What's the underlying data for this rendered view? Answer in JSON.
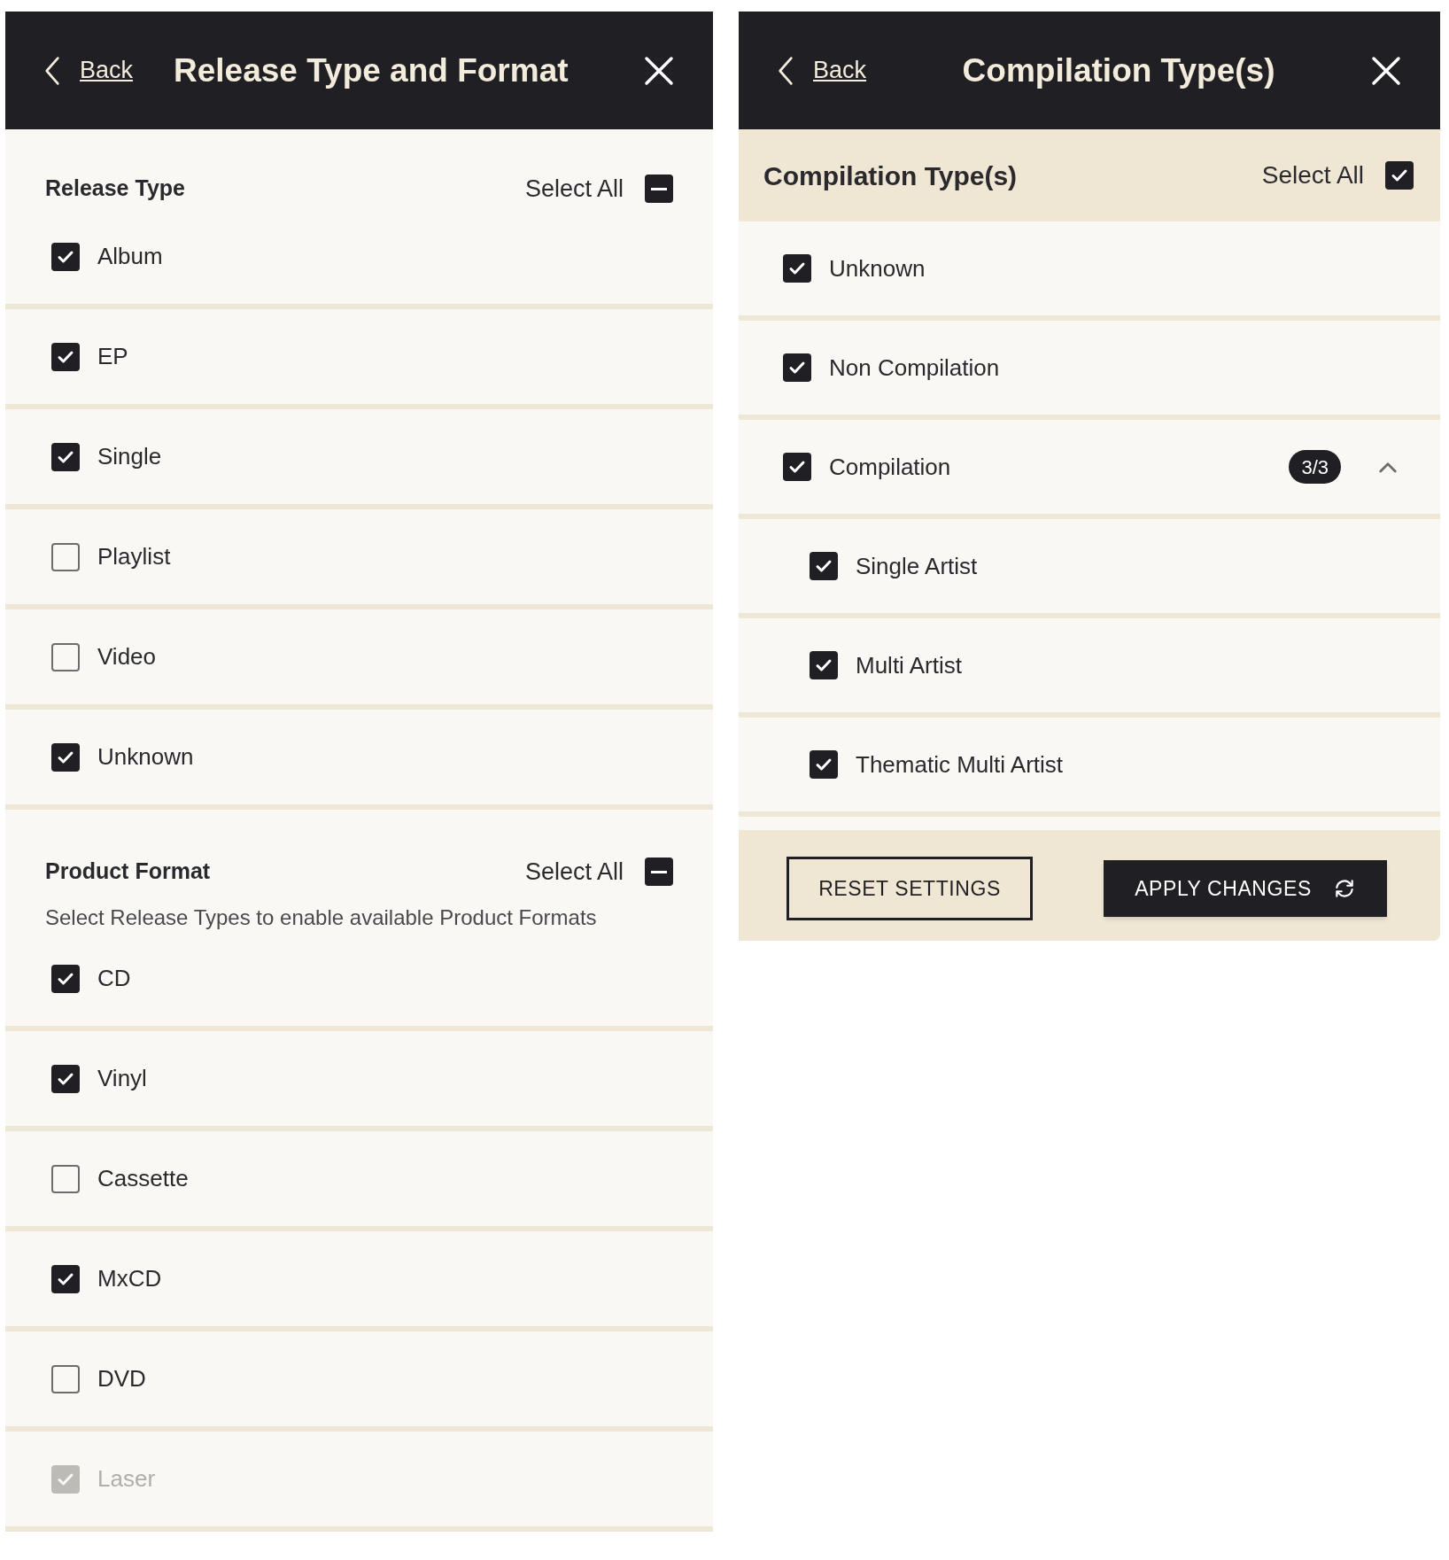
{
  "release_panel": {
    "header": {
      "back": "Back",
      "title": "Release Type and Format"
    },
    "sections": [
      {
        "title": "Release Type",
        "select_all": {
          "label": "Select All",
          "indeterminate": true
        },
        "items": [
          {
            "label": "Album",
            "checked": true,
            "disabled": false
          },
          {
            "label": "EP",
            "checked": true,
            "disabled": false
          },
          {
            "label": "Single",
            "checked": true,
            "disabled": false
          },
          {
            "label": "Playlist",
            "checked": false,
            "disabled": false
          },
          {
            "label": "Video",
            "checked": false,
            "disabled": false
          },
          {
            "label": "Unknown",
            "checked": true,
            "disabled": false
          }
        ]
      },
      {
        "title": "Product Format",
        "select_all": {
          "label": "Select All",
          "indeterminate": true
        },
        "hint": "Select Release Types to enable available Product Formats",
        "items": [
          {
            "label": "CD",
            "checked": true,
            "disabled": false
          },
          {
            "label": "Vinyl",
            "checked": true,
            "disabled": false
          },
          {
            "label": "Cassette",
            "checked": false,
            "disabled": false
          },
          {
            "label": "MxCD",
            "checked": true,
            "disabled": false
          },
          {
            "label": "DVD",
            "checked": false,
            "disabled": false
          },
          {
            "label": "Laser",
            "checked": true,
            "disabled": true
          }
        ]
      }
    ]
  },
  "compilation_panel": {
    "header": {
      "back": "Back",
      "title": "Compilation Type(s)"
    },
    "section": {
      "title": "Compilation Type(s)",
      "select_all": {
        "label": "Select All",
        "checked": true
      },
      "items": [
        {
          "label": "Unknown",
          "checked": true
        },
        {
          "label": "Non Compilation",
          "checked": true
        },
        {
          "label": "Compilation",
          "checked": true,
          "badge": "3/3",
          "expanded": true,
          "children": [
            {
              "label": "Single Artist",
              "checked": true
            },
            {
              "label": "Multi Artist",
              "checked": true
            },
            {
              "label": "Thematic Multi Artist",
              "checked": true
            }
          ]
        }
      ]
    },
    "buttons": {
      "reset": "RESET SETTINGS",
      "apply": "APPLY CHANGES"
    }
  }
}
